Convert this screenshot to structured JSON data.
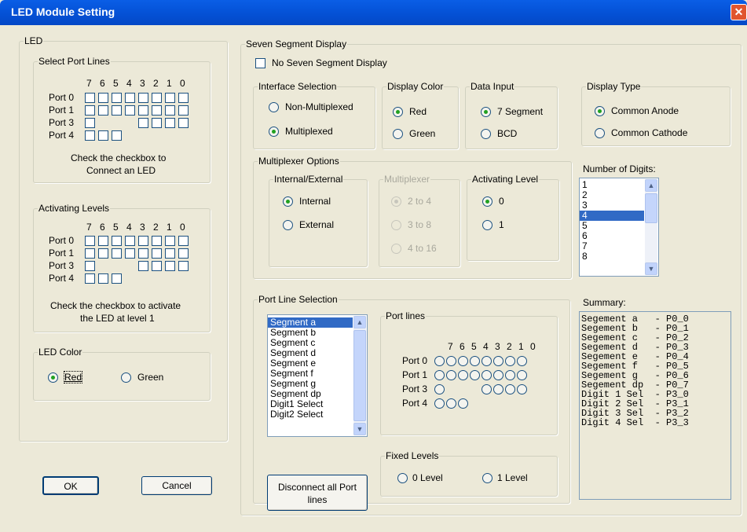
{
  "title": "LED Module Setting",
  "led": {
    "group_label": "LED",
    "port_lines": {
      "label": "Select Port Lines",
      "bits": [
        "7",
        "6",
        "5",
        "4",
        "3",
        "2",
        "1",
        "0"
      ],
      "ports": [
        "Port 0",
        "Port 1",
        "Port 3",
        "Port 4"
      ],
      "hint1": "Check the checkbox to",
      "hint2": "Connect an LED"
    },
    "activating": {
      "label": "Activating Levels",
      "bits": [
        "7",
        "6",
        "5",
        "4",
        "3",
        "2",
        "1",
        "0"
      ],
      "ports": [
        "Port 0",
        "Port 1",
        "Port 3",
        "Port 4"
      ],
      "hint1": "Check the checkbox to activate",
      "hint2": "the LED at level 1"
    },
    "color": {
      "label": "LED Color",
      "red": "Red",
      "green": "Green",
      "selected": "Red"
    }
  },
  "buttons": {
    "ok": "OK",
    "cancel": "Cancel",
    "disconnect1": "Disconnect all Port",
    "disconnect2": "lines"
  },
  "ssd": {
    "group_label": "Seven Segment Display",
    "no_ssd": "No Seven Segment Display",
    "interface": {
      "label": "Interface Selection",
      "opt1": "Non-Multiplexed",
      "opt2": "Multiplexed",
      "selected": "Multiplexed"
    },
    "display_color": {
      "label": "Display Color",
      "opt1": "Red",
      "opt2": "Green",
      "selected": "Red"
    },
    "data_input": {
      "label": "Data Input",
      "opt1": "7 Segment",
      "opt2": "BCD",
      "selected": "7 Segment"
    },
    "display_type": {
      "label": "Display Type",
      "opt1": "Common Anode",
      "opt2": "Common Cathode",
      "selected": "Common Anode"
    },
    "mux": {
      "label": "Multiplexer Options",
      "int_ext": {
        "label": "Internal/External",
        "opt1": "Internal",
        "opt2": "External",
        "selected": "Internal"
      },
      "multiplexer": {
        "label": "Multiplexer",
        "opt1": "2 to 4",
        "opt2": "3 to 8",
        "opt3": "4 to 16",
        "selected": "2 to 4"
      },
      "act_level": {
        "label": "Activating Level",
        "opt1": "0",
        "opt2": "1",
        "selected": "0"
      }
    },
    "digits": {
      "label": "Number of Digits:",
      "items": [
        "1",
        "2",
        "3",
        "4",
        "5",
        "6",
        "7",
        "8"
      ],
      "selected": "4"
    },
    "port_sel": {
      "label": "Port Line Selection",
      "segments": [
        "Segment a",
        "Segment b",
        "Segment c",
        "Segment d",
        "Segment e",
        "Segment f",
        "Segment g",
        "Segment dp",
        "Digit1 Select",
        "Digit2 Select"
      ],
      "selected": "Segment a",
      "port_lines_label": "Port lines",
      "bits": [
        "7",
        "6",
        "5",
        "4",
        "3",
        "2",
        "1",
        "0"
      ],
      "ports": [
        "Port 0",
        "Port 1",
        "Port 3",
        "Port 4"
      ]
    },
    "fixed": {
      "label": "Fixed Levels",
      "opt1": "0 Level",
      "opt2": "1 Level"
    },
    "summary": {
      "label": "Summary:",
      "lines": [
        "Segement a   - P0_0",
        "Segement b   - P0_1",
        "Segement c   - P0_2",
        "Segement d   - P0_3",
        "Segement e   - P0_4",
        "Segement f   - P0_5",
        "Segement g   - P0_6",
        "Segement dp  - P0_7",
        "Digit 1 Sel  - P3_0",
        "Digit 2 Sel  - P3_1",
        "Digit 3 Sel  - P3_2",
        "Digit 4 Sel  - P3_3"
      ]
    }
  }
}
